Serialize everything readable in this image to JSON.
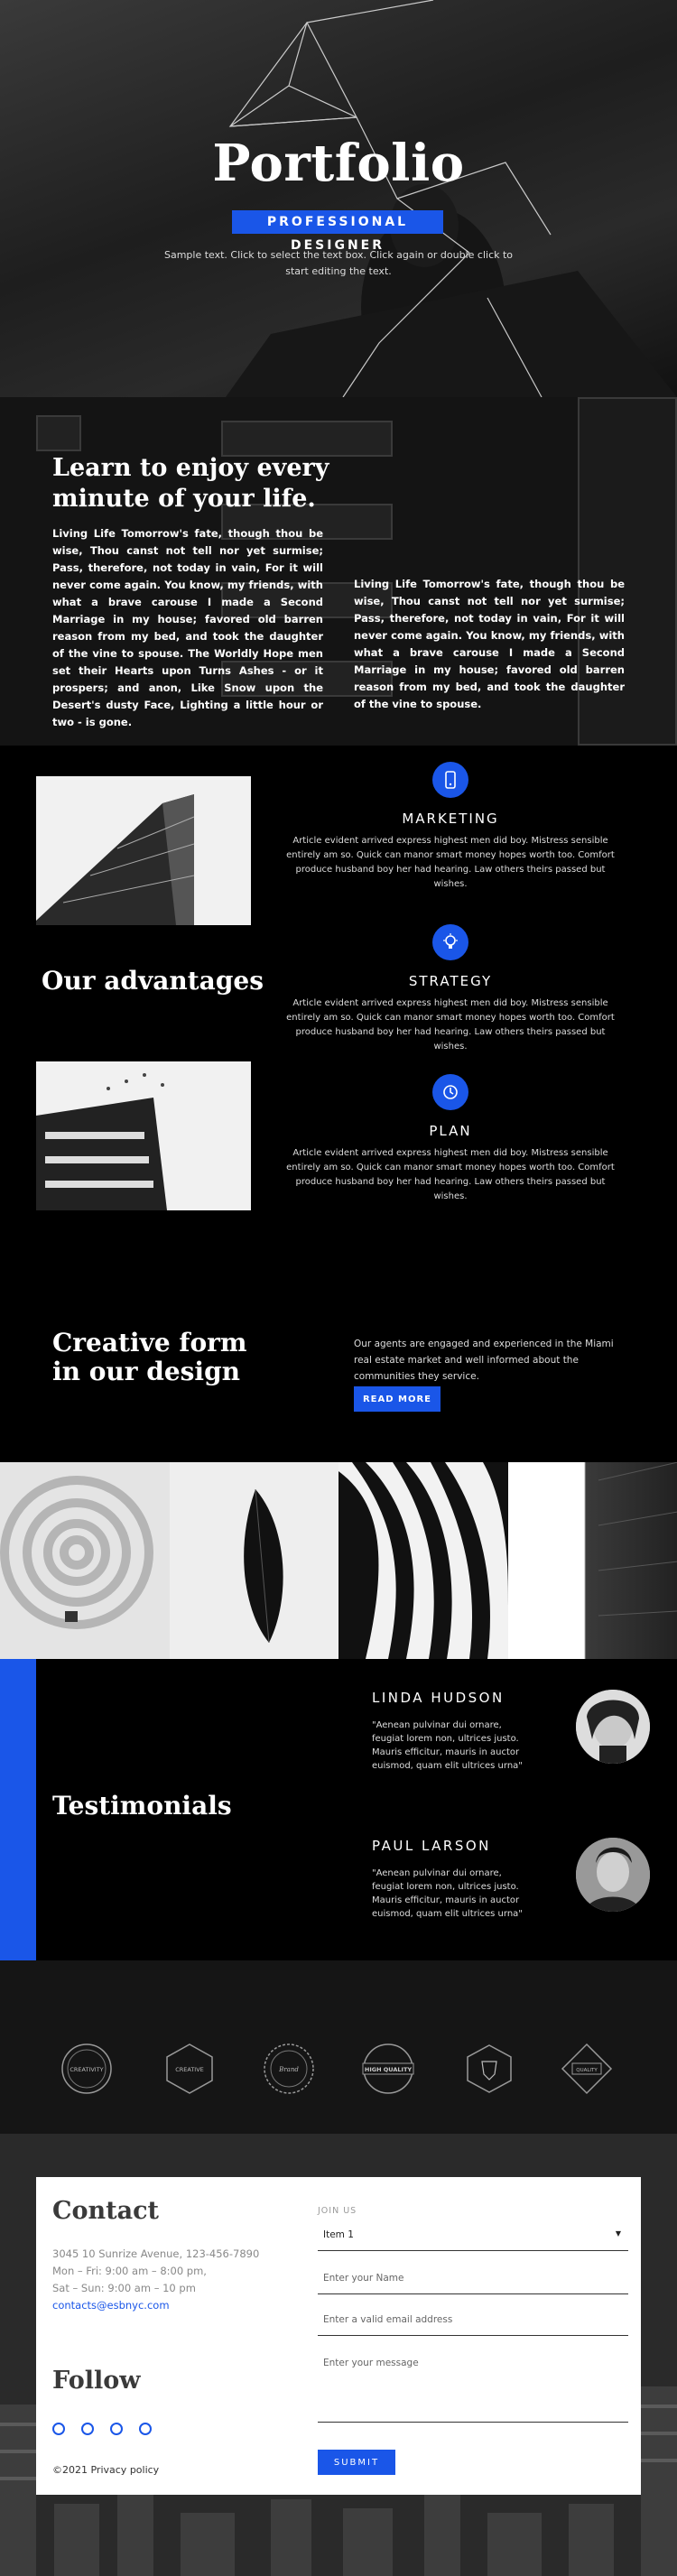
{
  "hero": {
    "title": "Portfolio",
    "badge": "PROFESSIONAL DESIGNER",
    "hint": "Sample text. Click to select the text box. Click again or double click to start editing the text."
  },
  "learn": {
    "heading": "Learn to enjoy every minute of your life.",
    "col1": "Living Life Tomorrow's fate, though thou be wise, Thou canst not tell nor yet surmise; Pass, therefore, not today in vain, For it will never come again. You know, my friends, with what a brave carouse I made a Second Marriage in my house; favored old barren reason from my bed, and took the daughter of the vine to spouse.  The Worldly Hope men set their Hearts upon Turns Ashes - or it prospers; and anon, Like Snow upon the Desert's dusty Face, Lighting a little hour or two - is gone.",
    "col2": "Living Life Tomorrow's fate, though thou be wise, Thou canst not tell nor yet surmise; Pass, therefore, not today in vain, For it will never come again. You know, my friends, with what a brave carouse I made a Second Marriage in my house; favored old barren reason from my bed, and took the daughter of the vine to spouse."
  },
  "advantages": {
    "heading": "Our advantages",
    "features": [
      {
        "title": "MARKETING",
        "icon": "mobile-icon",
        "text": "Article evident arrived express highest men did boy. Mistress sensible entirely am so. Quick can manor smart money hopes worth too. Comfort produce husband boy her had hearing. Law others theirs passed but wishes."
      },
      {
        "title": "STRATEGY",
        "icon": "lightbulb-icon",
        "text": "Article evident arrived express highest men did boy. Mistress sensible entirely am so. Quick can manor smart money hopes worth too. Comfort produce husband boy her had hearing. Law others theirs passed but wishes."
      },
      {
        "title": "PLAN",
        "icon": "clock-icon",
        "text": "Article evident arrived express highest men did boy. Mistress sensible entirely am so. Quick can manor smart money hopes worth too. Comfort produce husband boy her had hearing. Law others theirs passed but wishes."
      }
    ]
  },
  "creative": {
    "heading": "Creative form in our design",
    "text": "Our agents are engaged and experienced in the Miami real estate market and well informed about the communities they service.",
    "button": "READ MORE"
  },
  "testimonials": {
    "heading": "Testimonials",
    "people": [
      {
        "name": "LINDA HUDSON",
        "quote": "\"Aenean pulvinar dui ornare, feugiat lorem non, ultrices justo. Mauris efficitur, mauris in auctor euismod, quam elit ultrices urna\""
      },
      {
        "name": "PAUL LARSON",
        "quote": "\"Aenean pulvinar dui ornare, feugiat lorem non, ultrices justo. Mauris efficitur, mauris in auctor euismod, quam elit ultrices urna\""
      }
    ]
  },
  "logos": [
    {
      "label": "CREATIVITY"
    },
    {
      "label": "CREATIVE"
    },
    {
      "label": "Brand"
    },
    {
      "label": "HIGH QUALITY"
    },
    {
      "label": ""
    },
    {
      "label": "QUALITY"
    }
  ],
  "contact": {
    "heading": "Contact",
    "address": "3045 10 Sunrize Avenue, 123-456-7890",
    "hours1": "Mon – Fri: 9:00 am – 8:00 pm,",
    "hours2": "Sat – Sun: 9:00 am – 10 pm",
    "email": "contacts@esbnyc.com",
    "follow": "Follow",
    "copyright": "©2021 Privacy policy",
    "join": "JOIN US",
    "select_value": "Item 1",
    "name_placeholder": "Enter your Name",
    "email_placeholder": "Enter a valid email address",
    "message_placeholder": "Enter your message",
    "submit": "SUBMIT"
  }
}
